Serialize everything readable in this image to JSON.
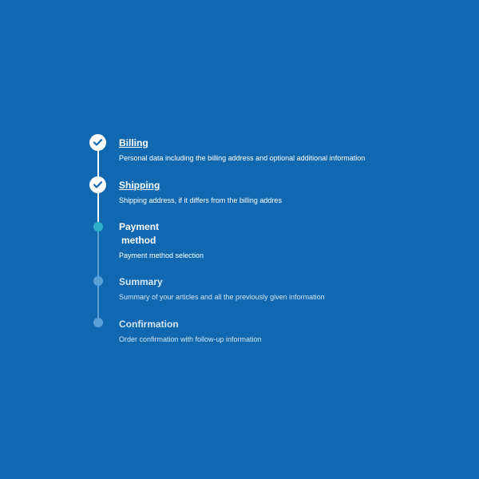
{
  "colors": {
    "background": "#1068b1",
    "completed": "#ffffff",
    "current": "#2bb0c8",
    "pending": "#5b9fd9"
  },
  "steps": [
    {
      "title": "Billing",
      "description": "Personal data including the billing address and optional additional information",
      "state": "completed",
      "icon": "check-icon"
    },
    {
      "title": "Shipping",
      "description": "Shipping address, if it differs from the billing addres",
      "state": "completed",
      "icon": "check-icon"
    },
    {
      "title_line1": "Payment",
      "title_line2": "method",
      "description": "Payment method selection",
      "state": "current"
    },
    {
      "title": "Summary",
      "description": "Summary of your articles and all the previously given information",
      "state": "pending"
    },
    {
      "title": "Confirmation",
      "description": "Order confirmation with follow-up information",
      "state": "pending"
    }
  ]
}
